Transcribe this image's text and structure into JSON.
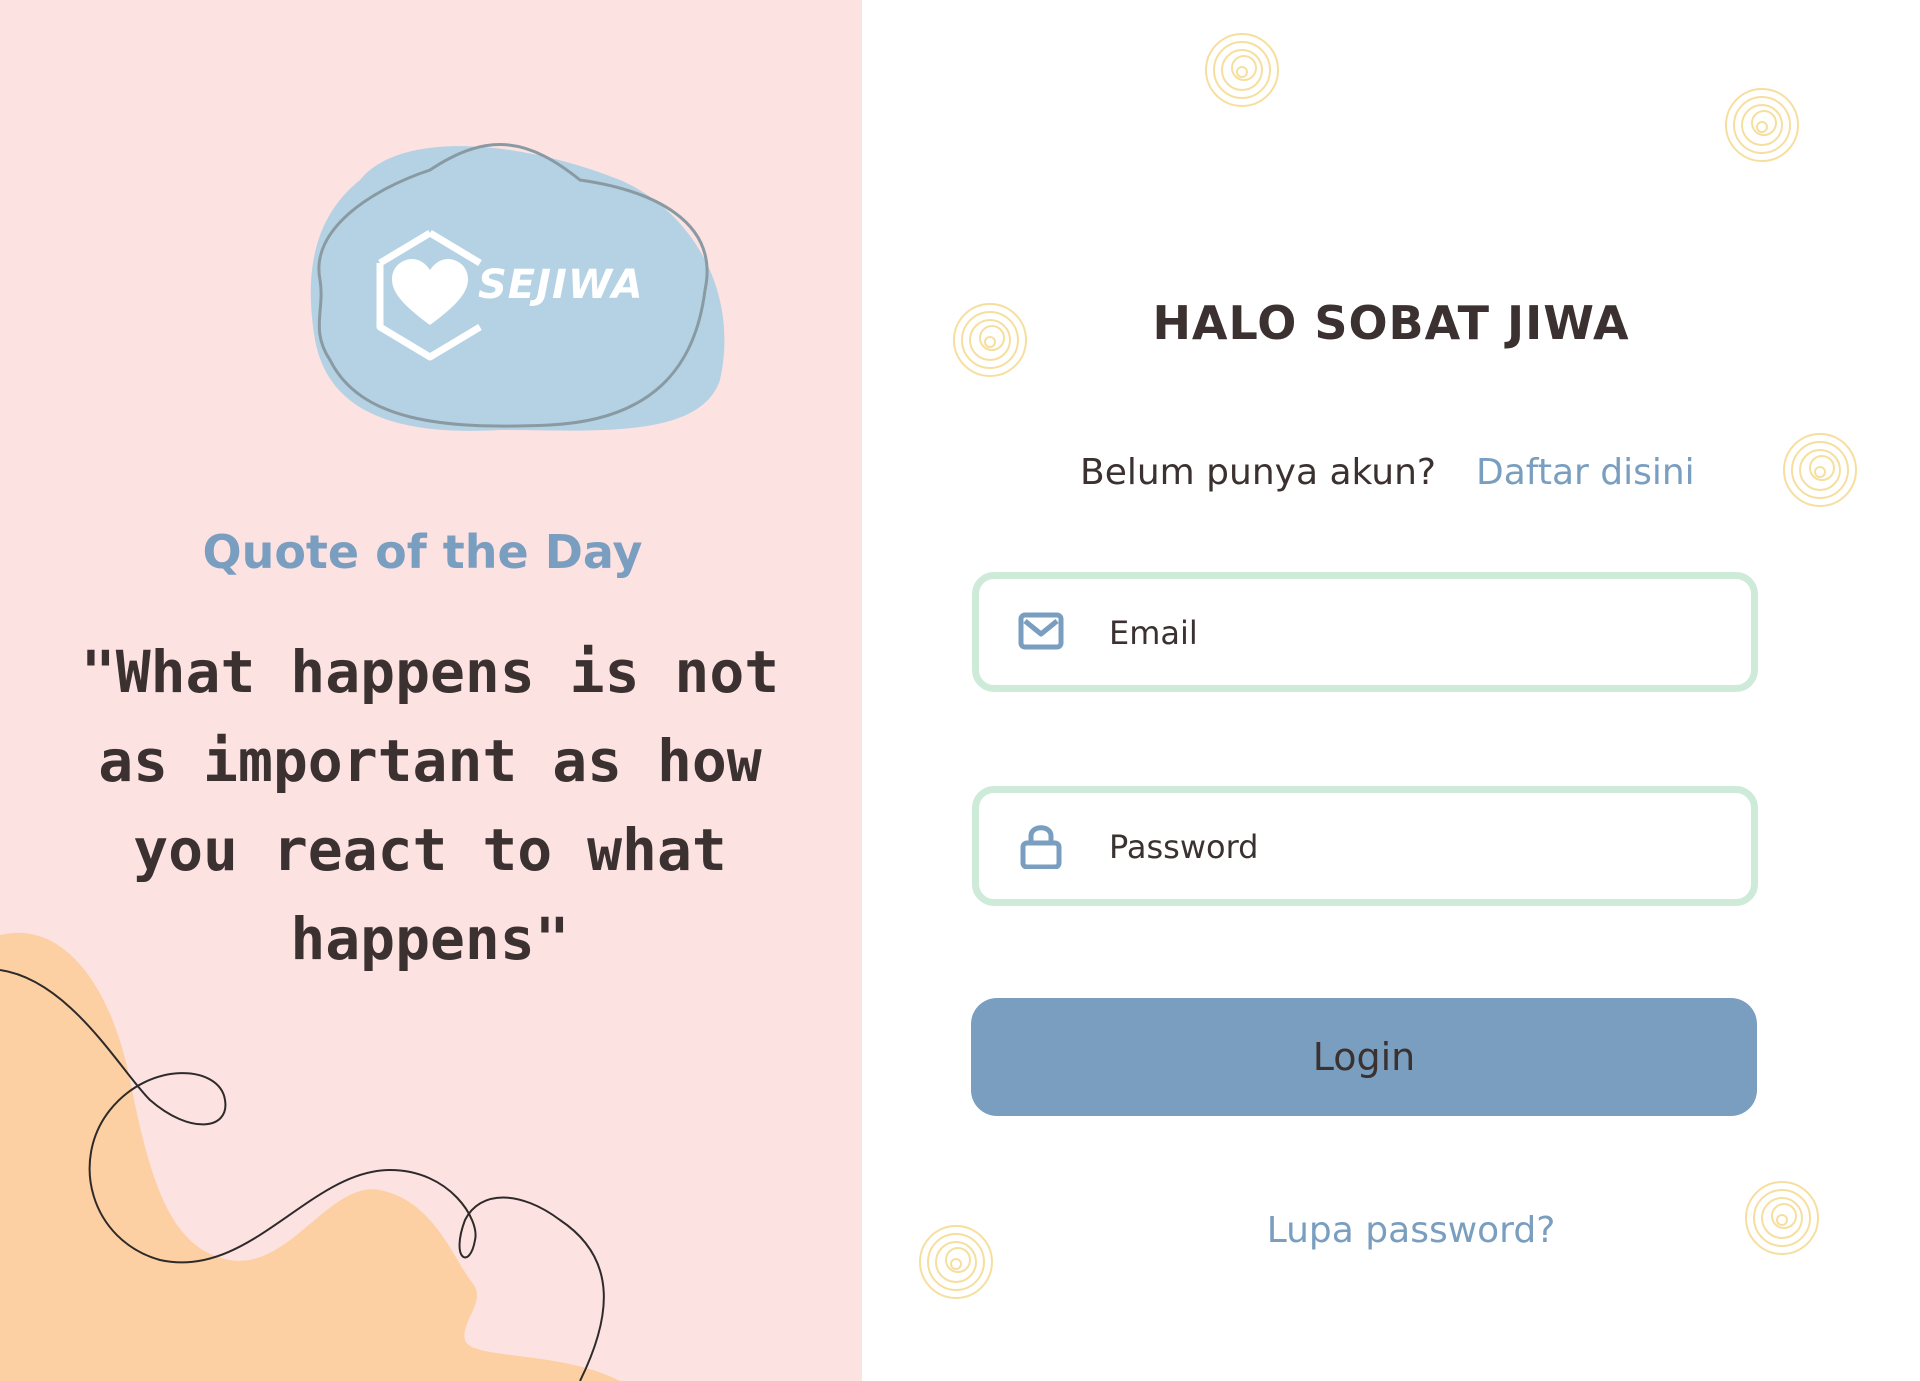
{
  "brand": {
    "name": "SEJIWA"
  },
  "quote": {
    "heading": "Quote of the Day",
    "text": "\"What happens is not as important as how you react to what happens\""
  },
  "login": {
    "greeting": "HALO SOBAT JIWA",
    "signup_prompt": "Belum punya akun?",
    "signup_link": "Daftar disini",
    "email_placeholder": "Email",
    "password_placeholder": "Password",
    "login_button": "Login",
    "forgot_link": "Lupa password?"
  },
  "colors": {
    "left_bg": "#fde2e2",
    "accent_blue": "#7a9ebf",
    "logo_blob": "#b4d2e3",
    "field_border": "#cdebd8",
    "text_dark": "#3b3130",
    "decor_orange": "#fdd0a4",
    "doodle_yellow": "#f6df9e"
  },
  "icons": {
    "email": "envelope-icon",
    "password": "lock-icon"
  }
}
